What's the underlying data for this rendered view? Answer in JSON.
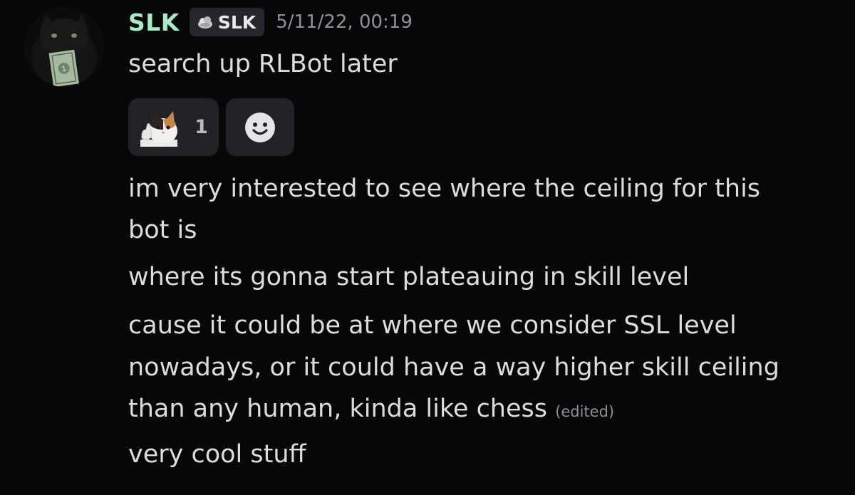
{
  "message": {
    "author": "SLK",
    "author_color": "#a9e8c8",
    "tag": {
      "label": "SLK",
      "icon": "cloud-tag-icon"
    },
    "timestamp": "5/11/22, 00:19",
    "lines": [
      "search up RLBot later",
      "im very interested to see where the ceiling for this",
      "bot is",
      "where its gonna start plateauing in skill level",
      "cause it could be at where we consider SSL level",
      "nowadays, or it could have a way higher skill ceiling",
      "than any human, kinda like chess",
      "very cool stuff"
    ],
    "edited_label": "(edited)",
    "reactions": [
      {
        "emoji": "cat-thumbs-up-emoji",
        "count": "1"
      }
    ],
    "add_reaction_icon": "smiley-add-reaction-icon"
  }
}
